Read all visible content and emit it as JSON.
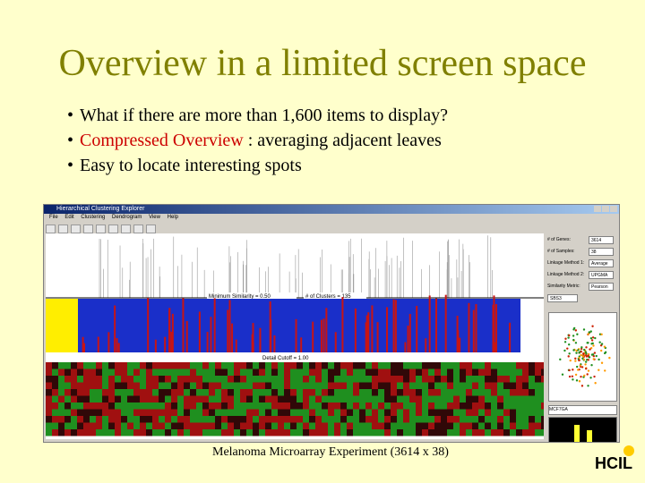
{
  "slide": {
    "title": "Overview in a limited screen space",
    "bullets": [
      {
        "prefix": "",
        "highlight": "",
        "text": "What if there are more than 1,600 items to display?"
      },
      {
        "prefix": "",
        "highlight": "Compressed Overview",
        "text": " : averaging adjacent leaves"
      },
      {
        "prefix": "",
        "highlight": "",
        "text": "Easy to locate interesting spots"
      }
    ],
    "caption": "Melanoma Microarray Experiment (3614 x 38)",
    "logo_text": "HCIL"
  },
  "app": {
    "window_title": "Hierarchical Clustering Explorer",
    "menu": [
      "File",
      "Edit",
      "Clustering",
      "Dendrogram",
      "View",
      "Help"
    ],
    "min_similarity_label": "Minimum Similarity = 0.50",
    "clusters_label": "# of Clusters = 135",
    "detail_cutoff_label": "Detail Cutoff = 1.00",
    "panel": {
      "fields": [
        {
          "label": "# of Genes:",
          "value": "3614"
        },
        {
          "label": "# of Samples:",
          "value": "38"
        },
        {
          "label": "Linkage Method 1:",
          "value": "Average"
        },
        {
          "label": "Linkage Method 2:",
          "value": "UPGMA"
        },
        {
          "label": "Similarity Metric:",
          "value": "Pearson"
        }
      ],
      "scatter_select": "SBS3",
      "hist_select": "MCF7GA"
    }
  },
  "colors": {
    "background": "#ffffcc",
    "title": "#808000",
    "highlight": "#cc0000",
    "dendro_blue": "#1a2fc9",
    "dendro_red": "#c81414",
    "heat_green": "#1f8f1f"
  }
}
